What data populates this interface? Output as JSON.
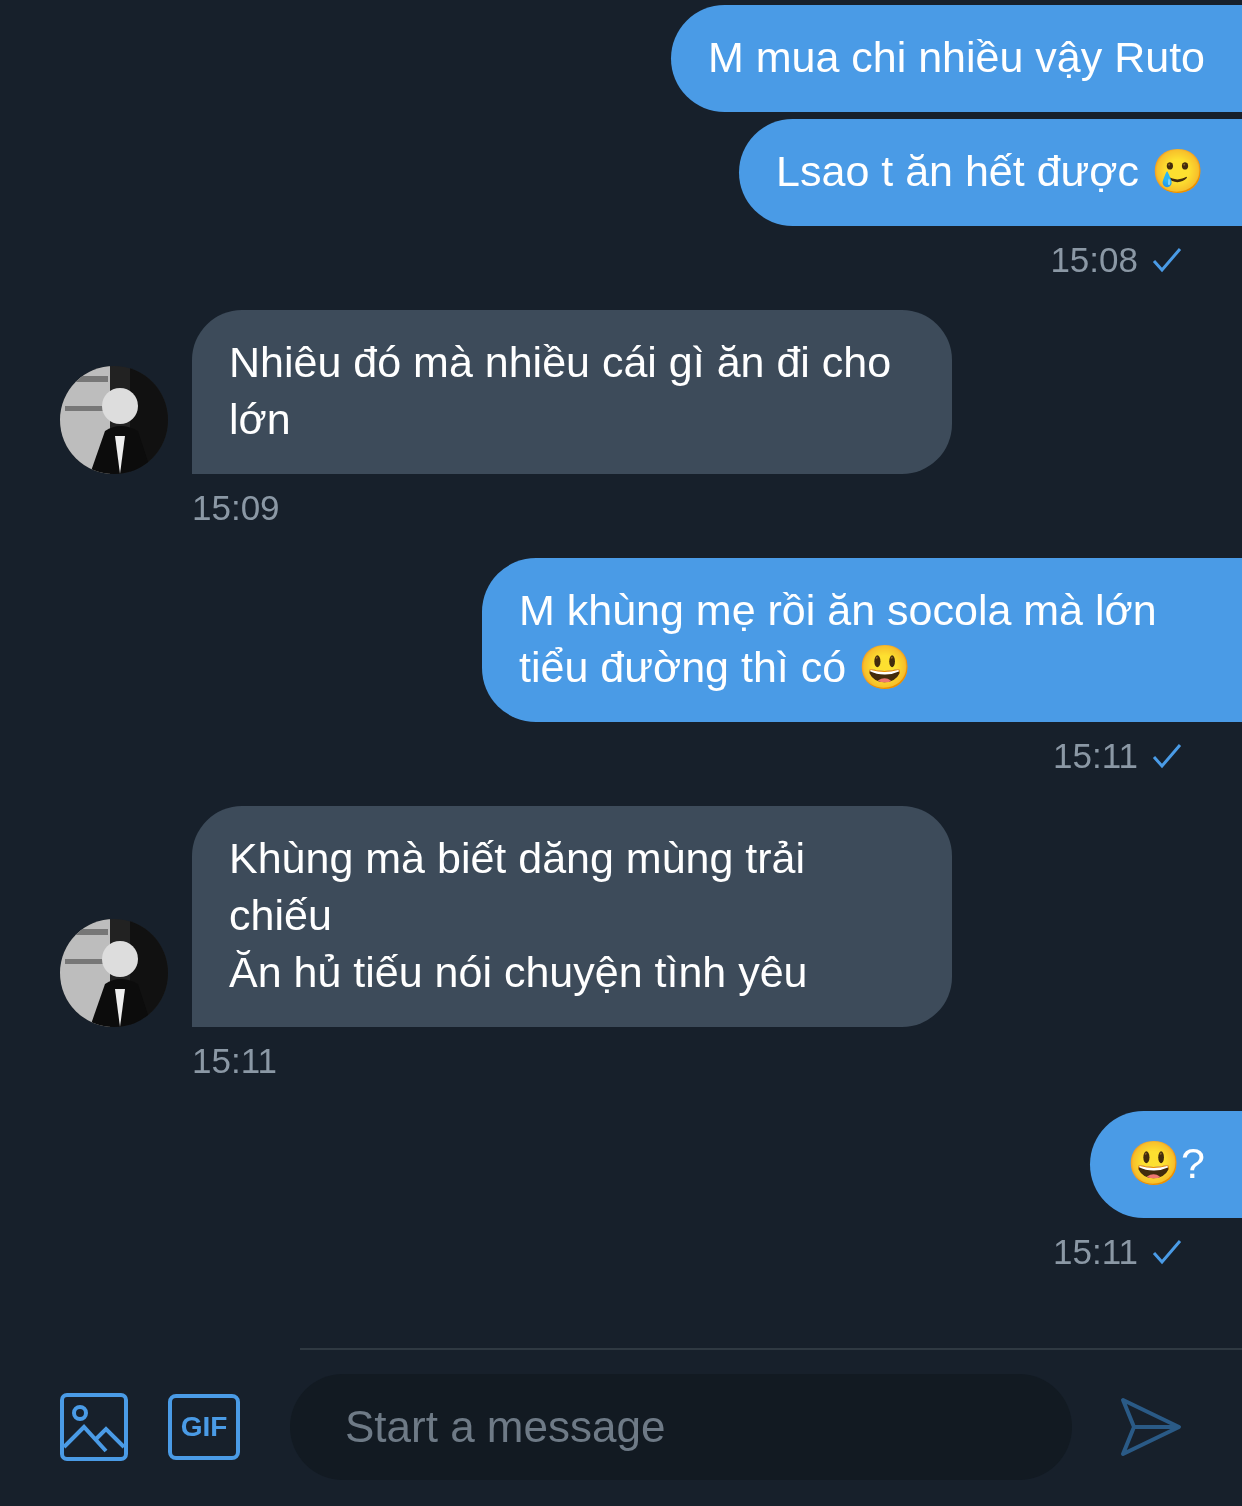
{
  "messages": [
    {
      "kind": "sent",
      "bubbles": [
        "M mua chi nhiều vậy Ruto",
        "Lsao t ăn hết được 🥲"
      ],
      "time": "15:08",
      "read": true
    },
    {
      "kind": "received",
      "bubbles": [
        "Nhiêu đó mà nhiều cái gì ăn đi cho lớn"
      ],
      "time": "15:09"
    },
    {
      "kind": "sent",
      "bubbles": [
        "M khùng mẹ rồi ăn socola mà lớn tiểu đường thì có 😃"
      ],
      "time": "15:11",
      "read": true
    },
    {
      "kind": "received",
      "bubbles": [
        "Khùng mà biết dăng mùng trải chiếu\nĂn hủ tiếu nói chuyện tình yêu"
      ],
      "time": "15:11"
    },
    {
      "kind": "sent",
      "bubbles": [
        "😃?"
      ],
      "time": "15:11",
      "read": true
    }
  ],
  "composer": {
    "placeholder": "Start a message",
    "gif_label": "GIF"
  }
}
